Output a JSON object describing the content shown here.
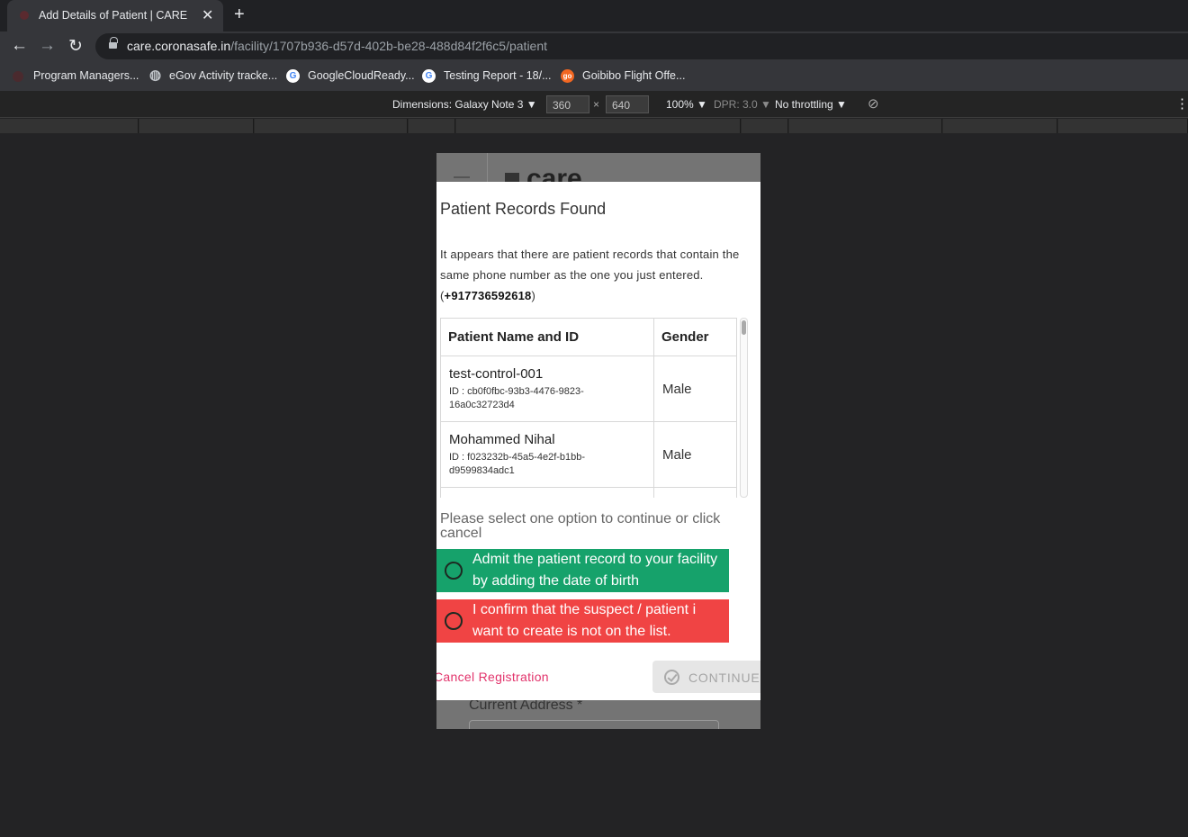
{
  "browser": {
    "tab_title": "Add Details of Patient | CARE",
    "tab_close": "✕",
    "new_tab": "+",
    "url_host": "care.coronasafe.in",
    "url_path": "/facility/1707b936-d57d-402b-be28-488d84f2f6c5/patient",
    "back_icon": "←",
    "forward_icon": "→",
    "reload_icon": "↻",
    "bookmarks": [
      {
        "label": "Program Managers...",
        "icon": "app-icon"
      },
      {
        "label": "eGov Activity tracke...",
        "icon": "globe-icon"
      },
      {
        "label": "GoogleCloudReady...",
        "icon": "google-icon"
      },
      {
        "label": "Testing Report - 18/...",
        "icon": "google-icon"
      },
      {
        "label": "Goibibo Flight Offe...",
        "icon": "goibibo-icon"
      }
    ],
    "bookmark_glyphs": {
      "globe": "◍",
      "google": "G",
      "goibibo": "go"
    }
  },
  "devtools": {
    "dimensions_label": "Dimensions: Galaxy Note 3 ▼",
    "width": "360",
    "times": "×",
    "height": "640",
    "zoom": "100% ▼",
    "dpr": "DPR: 3.0 ▼",
    "throttling": "No throttling ▼",
    "rotate_icon": "⊘",
    "more_icon": "⋮"
  },
  "app": {
    "logo": "care",
    "bg_label": "Current Address *"
  },
  "dialog": {
    "title": "Patient Records Found",
    "message": "It appears that there are patient records that contain the same phone number as the one you just entered.",
    "phone_open": "(",
    "phone": "+917736592618",
    "phone_close": ")",
    "table": {
      "headers": [
        "Patient Name and ID",
        "Gender"
      ],
      "rows": [
        {
          "name": "test-control-001",
          "id": "ID : cb0f0fbc-93b3-4476-9823-16a0c32723d4",
          "gender": "Male"
        },
        {
          "name": "Mohammed Nihal",
          "id": "ID : f023232b-45a5-4e2f-b1bb-d9599834adc1",
          "gender": "Male"
        }
      ]
    },
    "prompt": "Please select one option to continue or click cancel",
    "options": [
      {
        "label": "Admit the patient record to your facility by adding the date of birth",
        "color": "#16a26b"
      },
      {
        "label": "I confirm that the suspect / patient i want to create is not on the list.",
        "color": "#f04444"
      }
    ],
    "cancel_label": "Cancel Registration",
    "continue_label": "CONTINUE"
  }
}
